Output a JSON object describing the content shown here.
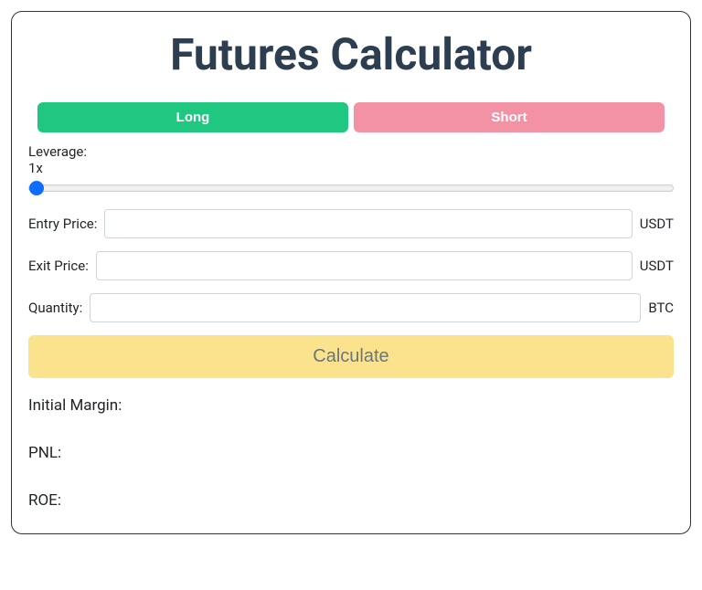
{
  "title": "Futures Calculator",
  "positions": {
    "long_label": "Long",
    "short_label": "Short"
  },
  "leverage": {
    "label": "Leverage:",
    "value_display": "1x",
    "value": 1,
    "min": 1,
    "max": 125
  },
  "inputs": {
    "entry_price": {
      "label": "Entry Price:",
      "value": "",
      "unit": "USDT"
    },
    "exit_price": {
      "label": "Exit Price:",
      "value": "",
      "unit": "USDT"
    },
    "quantity": {
      "label": "Quantity:",
      "value": "",
      "unit": "BTC"
    }
  },
  "calculate_label": "Calculate",
  "results": {
    "initial_margin": {
      "label": "Initial Margin:",
      "value": ""
    },
    "pnl": {
      "label": "PNL:",
      "value": ""
    },
    "roe": {
      "label": "ROE:",
      "value": ""
    }
  }
}
